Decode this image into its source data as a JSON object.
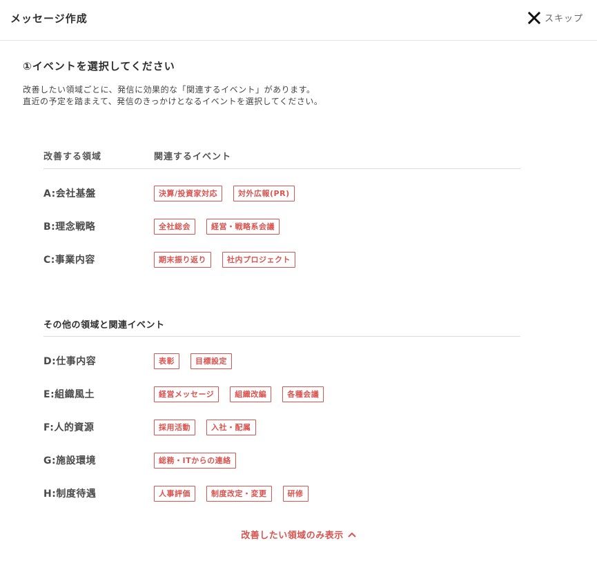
{
  "header": {
    "title": "メッセージ作成",
    "skip_label": "スキップ"
  },
  "step": {
    "title": "①イベントを選択してください",
    "description_lines": [
      "改善したい領域ごとに、発信に効果的な「関連するイベント」があります。",
      "直近の予定を踏まえて、発信のきっかけとなるイベントを選択してください。"
    ]
  },
  "table": {
    "col_area": "改善する領域",
    "col_events": "関連するイベント"
  },
  "primary_rows": [
    {
      "label": "A:会社基盤",
      "tags": [
        "決算/投資家対応",
        "対外広報(PR)"
      ]
    },
    {
      "label": "B:理念戦略",
      "tags": [
        "全社総会",
        "経営・戦略系会議"
      ]
    },
    {
      "label": "C:事業内容",
      "tags": [
        "期末振り返り",
        "社内プロジェクト"
      ]
    }
  ],
  "other_section": {
    "title": "その他の領域と関連イベント"
  },
  "other_rows": [
    {
      "label": "D:仕事内容",
      "tags": [
        "表彰",
        "目標設定"
      ]
    },
    {
      "label": "E:組織風土",
      "tags": [
        "経営メッセージ",
        "組織改編",
        "各種会議"
      ]
    },
    {
      "label": "F:人的資源",
      "tags": [
        "採用活動",
        "入社・配属"
      ]
    },
    {
      "label": "G:施設環境",
      "tags": [
        "総務・ITからの連絡"
      ]
    },
    {
      "label": "H:制度待遇",
      "tags": [
        "人事評価",
        "制度改定・変更",
        "研修"
      ]
    }
  ],
  "toggle": {
    "label": "改善したい領域のみ表示"
  },
  "colors": {
    "accent": "#d9534f",
    "text": "#2e2e2e",
    "divider": "#dcdcdc"
  }
}
